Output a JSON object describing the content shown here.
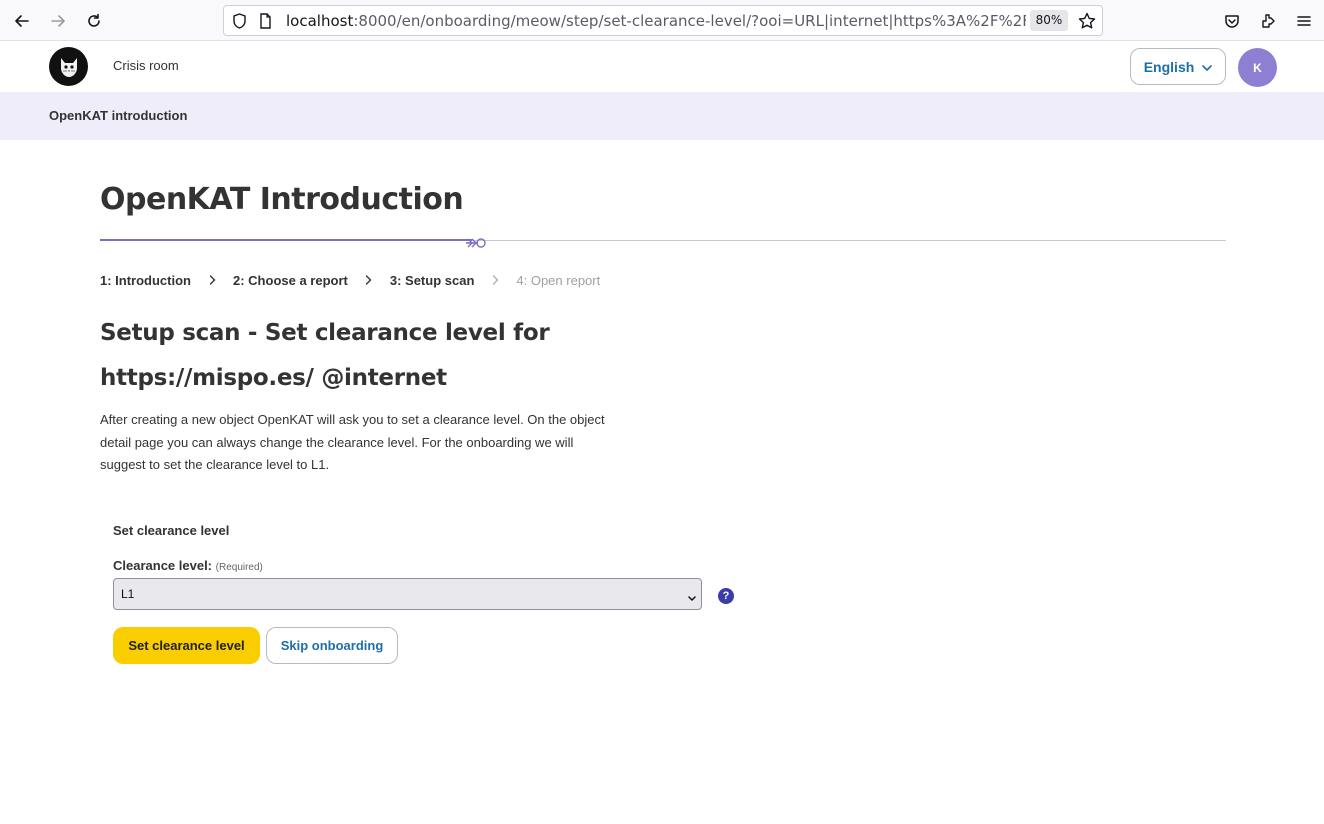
{
  "browser": {
    "url_host": "localhost",
    "url_rest": ":8000/en/onboarding/meow/step/set-clearance-level/?ooi=URL|internet|https%3A%2F%2Fmispo",
    "zoom": "80%",
    "icons": [
      "back-arrow-icon",
      "forward-arrow-icon",
      "reload-icon",
      "shield-icon",
      "page-info-icon",
      "bookmark-star-icon",
      "pocket-icon",
      "extensions-icon",
      "menu-icon"
    ]
  },
  "header": {
    "nav_link": "Crisis room",
    "language_label": "English",
    "avatar_initial": "K"
  },
  "subnav": {
    "title": "OpenKAT introduction"
  },
  "main": {
    "title": "OpenKAT Introduction",
    "progress": 0.33,
    "steps": [
      {
        "label": "1: Introduction",
        "state": "done"
      },
      {
        "label": "2: Choose a report",
        "state": "done"
      },
      {
        "label": "3: Setup scan",
        "state": "current"
      },
      {
        "label": "4: Open report",
        "state": "upcoming"
      }
    ],
    "section_title": "Setup scan - Set clearance level for https://mispo.es/ @internet",
    "intro_text": "After creating a new object OpenKAT will ask you to set a clearance level. On the object detail page you can always change the clearance level. For the onboarding we will suggest to set the clearance level to L1."
  },
  "form": {
    "title": "Set clearance level",
    "field_label": "Clearance level:",
    "field_required": "(Required)",
    "selected_value": "L1",
    "help_symbol": "?",
    "submit_label": "Set clearance level",
    "skip_label": "Skip onboarding"
  },
  "colors": {
    "accent_yellow": "#f9cd00",
    "link_blue": "#1e6fa8",
    "progress_purple": "#7b6fc4",
    "subnav_bg": "#efedf9",
    "avatar_bg": "#8e7fd3"
  }
}
